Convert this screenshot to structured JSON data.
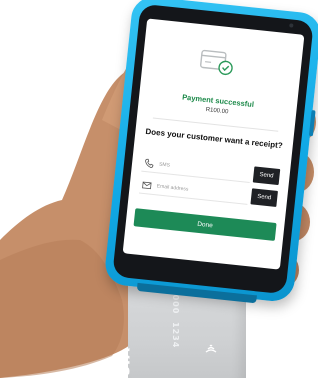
{
  "screen": {
    "status_icon": "card-check-icon",
    "title": "Payment successful",
    "amount": "R100.00",
    "prompt": "Does your customer want a receipt?",
    "sms": {
      "icon": "phone-icon",
      "placeholder": "SMS",
      "button_label": "Send"
    },
    "email": {
      "icon": "envelope-icon",
      "placeholder": "Email address",
      "button_label": "Send"
    },
    "done_label": "Done"
  },
  "card": {
    "brand": "VISA",
    "number_fragments": [
      "4000",
      "1234"
    ]
  },
  "colors": {
    "device_body": "#1fb5ee",
    "success_green": "#1d8a4a",
    "done_button": "#1d8a57",
    "send_button": "#1f2125"
  }
}
